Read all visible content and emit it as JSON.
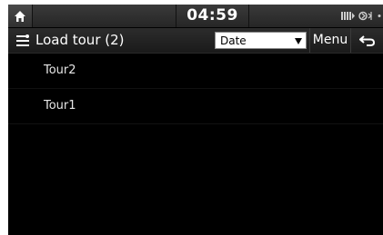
{
  "status": {
    "time": "04:59",
    "icons": [
      "home-icon",
      "battery-icon",
      "bluetooth-icon"
    ]
  },
  "titlebar": {
    "title": "Load tour (2)",
    "icon": "tour-list-icon",
    "sort": {
      "value": "Date"
    },
    "menu_label": "Menu",
    "back_icon": "back-arrow-icon"
  },
  "tours": [
    {
      "name": "Tour2"
    },
    {
      "name": "Tour1"
    }
  ],
  "colors": {
    "background": "#000000",
    "bar": "#2c2c2c",
    "text": "#ffffff"
  }
}
